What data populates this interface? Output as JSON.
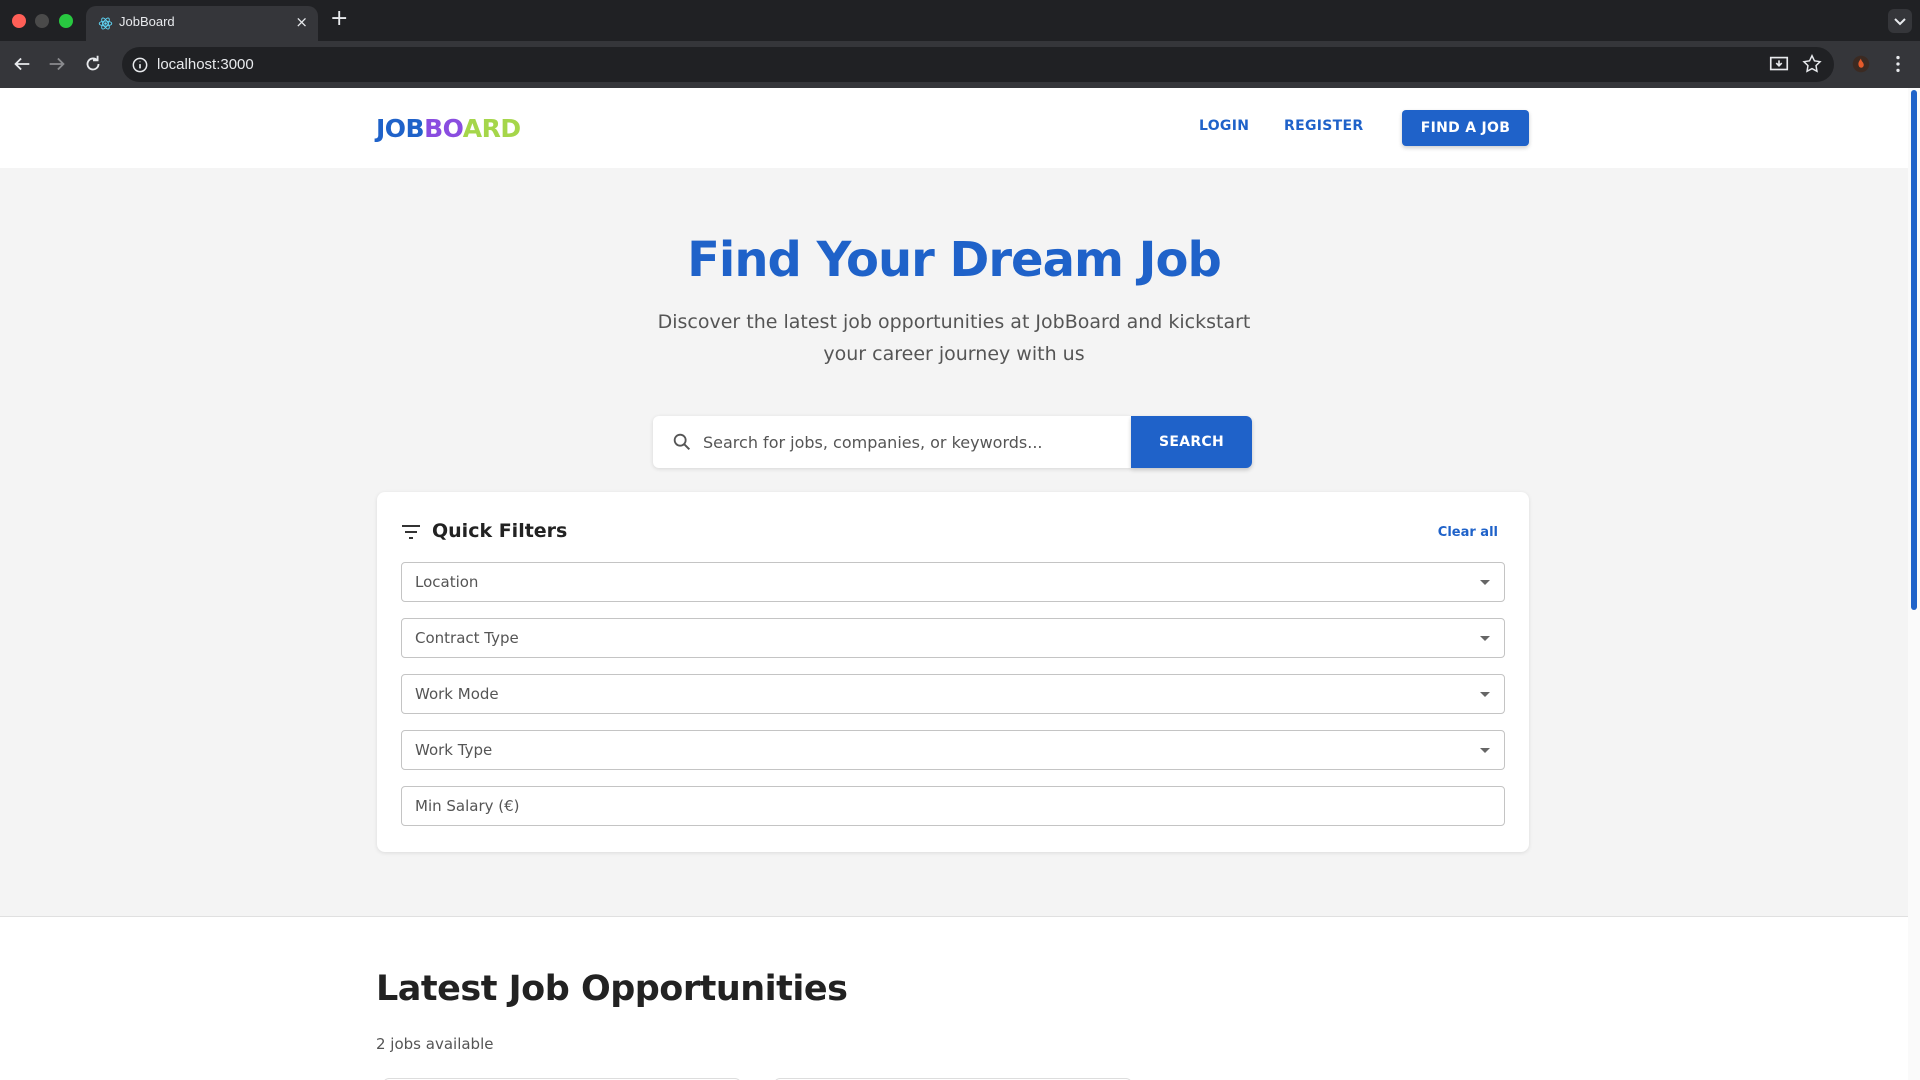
{
  "browser": {
    "tab_title": "JobBoard",
    "tab_close": "×",
    "new_tab": "+",
    "url": "localhost:3000"
  },
  "header": {
    "logo": {
      "part1": "JOB",
      "part2": "BO",
      "part3": "ARD"
    },
    "login_label": "LOGIN",
    "register_label": "REGISTER",
    "find_job_label": "FIND A JOB"
  },
  "hero": {
    "title": "Find Your Dream Job",
    "subtitle": "Discover the latest job opportunities at JobBoard and kickstart your career journey with us"
  },
  "search": {
    "placeholder": "Search for jobs, companies, or keywords...",
    "button_label": "SEARCH"
  },
  "filters": {
    "title": "Quick Filters",
    "clear_label": "Clear all",
    "fields": [
      {
        "label": "Location"
      },
      {
        "label": "Contract Type"
      },
      {
        "label": "Work Mode"
      },
      {
        "label": "Work Type"
      },
      {
        "label": "Min Salary (€)"
      }
    ]
  },
  "jobs": {
    "title": "Latest Job Opportunities",
    "count": "2 jobs available"
  },
  "colors": {
    "primary": "#1f62c9",
    "logo_purple": "#8a4de0",
    "logo_green": "#a5d64a"
  },
  "icons": [
    "react-favicon-icon",
    "back-icon",
    "forward-icon",
    "reload-icon",
    "info-icon",
    "install-icon",
    "star-icon",
    "profile-icon",
    "kebab-menu-icon",
    "search-icon",
    "filter-icon",
    "chevron-down-icon"
  ]
}
